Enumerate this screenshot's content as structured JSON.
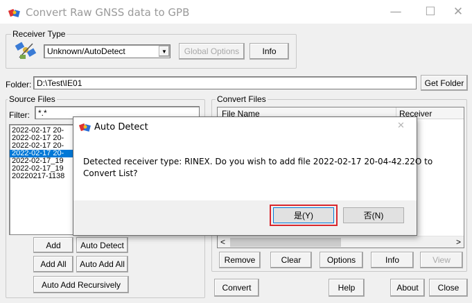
{
  "window": {
    "title": "Convert Raw GNSS data to GPB",
    "min": "—",
    "max": "☐",
    "close": "✕"
  },
  "receiver": {
    "group_label": "Receiver Type",
    "selected": "Unknown/AutoDetect",
    "global_options_label": "Global Options",
    "info_label": "Info"
  },
  "folder": {
    "label": "Folder:",
    "value": "D:\\Test\\IE01",
    "get_folder_label": "Get Folder"
  },
  "source": {
    "group_label": "Source Files",
    "filter_label": "Filter:",
    "filter_value": "*.*",
    "files": [
      "2022-02-17 20-",
      "2022-02-17 20-",
      "2022-02-17 20-",
      "2022-02-17 20-",
      "2022-02-17_19",
      "2022-02-17_19",
      "20220217-1138"
    ],
    "selected_index": 3,
    "add_label": "Add",
    "auto_detect_label": "Auto Detect",
    "add_all_label": "Add All",
    "auto_add_all_label": "Auto Add All",
    "auto_add_recursively_label": "Auto Add Recursively"
  },
  "convert": {
    "group_label": "Convert Files",
    "col_file_name": "File Name",
    "col_receiver": "Receiver",
    "remove_label": "Remove",
    "clear_label": "Clear",
    "options_label": "Options",
    "info_label": "Info",
    "view_label": "View",
    "scroll_left": "<",
    "scroll_right": ">"
  },
  "footer": {
    "convert_label": "Convert",
    "help_label": "Help",
    "about_label": "About",
    "close_label": "Close"
  },
  "dialog": {
    "title": "Auto Detect",
    "close": "✕",
    "message_line1": "Detected receiver type: RINEX. Do you wish to add file 2022-02-17 20-04-42.22O to",
    "message_line2": "Convert List?",
    "yes_label": "是(Y)",
    "no_label": "否(N)"
  },
  "colors": {
    "selection": "#0078d7",
    "focus_border": "#d9262c"
  }
}
